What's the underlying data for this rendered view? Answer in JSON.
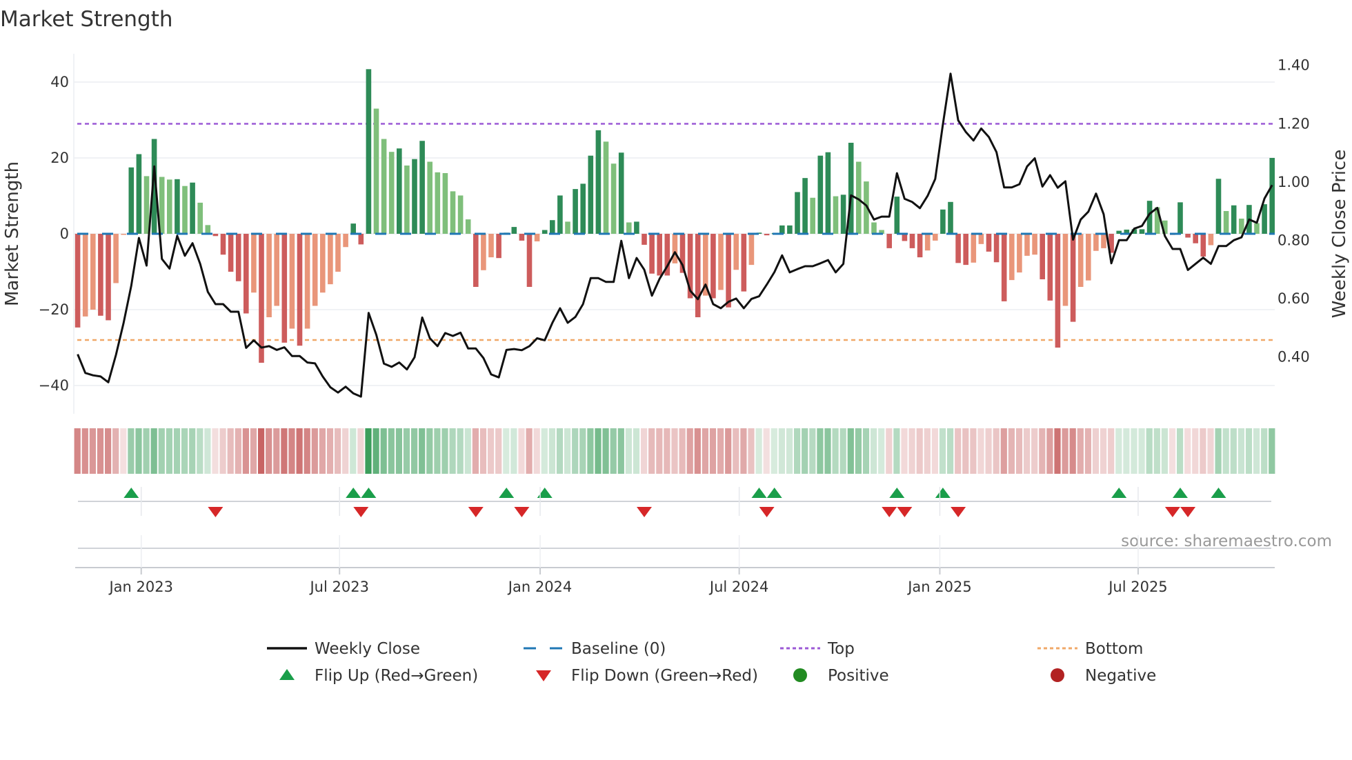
{
  "chart_data": {
    "type": "bar",
    "title": "Market Strength",
    "ylabel": "Market Strength",
    "y2label": "Weekly Close Price",
    "source": "source: sharemaestro.com",
    "ylim": [
      -47,
      50
    ],
    "y2lim": [
      0.22,
      1.5
    ],
    "yticks": [
      {
        "v": 40,
        "label": "40"
      },
      {
        "v": 20,
        "label": "20"
      },
      {
        "v": 0,
        "label": "0"
      },
      {
        "v": -20,
        "label": "−20"
      },
      {
        "v": -40,
        "label": "−40"
      }
    ],
    "y2ticks": [
      {
        "v": 1.4,
        "label": "1.40"
      },
      {
        "v": 1.2,
        "label": "1.20"
      },
      {
        "v": 1.0,
        "label": "1.00"
      },
      {
        "v": 0.8,
        "label": "0.80"
      },
      {
        "v": 0.6,
        "label": "0.60"
      },
      {
        "v": 0.4,
        "label": "0.40"
      }
    ],
    "xticks": [
      {
        "week": 8.3,
        "label": "Jan 2023"
      },
      {
        "week": 34.2,
        "label": "Jul 2023"
      },
      {
        "week": 60.4,
        "label": "Jan 2024"
      },
      {
        "week": 86.4,
        "label": "Jul 2024"
      },
      {
        "week": 112.6,
        "label": "Jan 2025"
      },
      {
        "week": 138.5,
        "label": "Jul 2025"
      }
    ],
    "top_level": 29,
    "bottom_level": -28,
    "baseline": 0,
    "strength": [
      -24.7,
      -21.8,
      -20,
      -21.6,
      -22.8,
      -13,
      -0.2,
      17.5,
      21,
      15.2,
      25,
      15,
      14.3,
      14.4,
      12.6,
      13.5,
      8.2,
      2.3,
      -0.6,
      -5.5,
      -10,
      -12.5,
      -21,
      -15.5,
      -34,
      -22,
      -19,
      -28.7,
      -25,
      -29.5,
      -25,
      -19,
      -15.5,
      -13.3,
      -10,
      -3.5,
      2.7,
      -2.8,
      43.4,
      33,
      25,
      21.6,
      22.5,
      18,
      19.7,
      24.5,
      19,
      16.2,
      16,
      11.2,
      10.1,
      3.8,
      -14,
      -9.6,
      -6.2,
      -6.4,
      0.3,
      1.8,
      -1.8,
      -14,
      -2,
      1,
      3.6,
      10.1,
      3.2,
      11.8,
      13.2,
      20.6,
      27.3,
      24.3,
      18.5,
      21.4,
      3,
      3.2,
      -2.9,
      -10.5,
      -11,
      -11,
      -7.8,
      -10.3,
      -17,
      -22,
      -16.3,
      -17,
      -14.8,
      -19.4,
      -9.5,
      -15.2,
      -8.2,
      0.3,
      -0.4,
      0.2,
      2.2,
      2.2,
      11,
      14.7,
      9.5,
      20.6,
      21.5,
      9.9,
      10.3,
      24,
      19,
      13.8,
      3,
      1,
      -3.8,
      9.8,
      -1.9,
      -3.8,
      -6.2,
      -4.4,
      -1.8,
      6.4,
      8.4,
      -7.7,
      -8.2,
      -7.6,
      -2.7,
      -4.7,
      -7.5,
      -17.8,
      -12.2,
      -10.2,
      -5.8,
      -5.5,
      -12,
      -17.6,
      -30,
      -19,
      -23.2,
      -14,
      -12.3,
      -4.5,
      -3.8,
      -5,
      0.8,
      1.1,
      1.2,
      1.2,
      8.7,
      7,
      3.5,
      -0.3,
      8.3,
      -1,
      -2.5,
      -6,
      -3,
      14.5,
      6,
      7.5,
      4,
      7.6,
      2.8,
      7.8,
      20
    ],
    "close": [
      0.407,
      0.343,
      0.335,
      0.331,
      0.311,
      0.405,
      0.515,
      0.642,
      0.806,
      0.711,
      1.051,
      0.734,
      0.701,
      0.813,
      0.745,
      0.788,
      0.717,
      0.621,
      0.579,
      0.579,
      0.553,
      0.553,
      0.429,
      0.455,
      0.43,
      0.435,
      0.422,
      0.431,
      0.401,
      0.401,
      0.379,
      0.376,
      0.331,
      0.294,
      0.276,
      0.296,
      0.273,
      0.262,
      0.549,
      0.474,
      0.375,
      0.364,
      0.379,
      0.355,
      0.397,
      0.533,
      0.462,
      0.435,
      0.48,
      0.47,
      0.481,
      0.427,
      0.427,
      0.394,
      0.338,
      0.328,
      0.422,
      0.425,
      0.421,
      0.435,
      0.462,
      0.455,
      0.515,
      0.565,
      0.515,
      0.535,
      0.579,
      0.668,
      0.668,
      0.655,
      0.655,
      0.796,
      0.668,
      0.737,
      0.697,
      0.608,
      0.666,
      0.709,
      0.757,
      0.713,
      0.625,
      0.596,
      0.646,
      0.579,
      0.565,
      0.587,
      0.598,
      0.565,
      0.597,
      0.606,
      0.646,
      0.689,
      0.746,
      0.688,
      0.699,
      0.709,
      0.709,
      0.719,
      0.73,
      0.688,
      0.717,
      0.952,
      0.938,
      0.917,
      0.869,
      0.879,
      0.879,
      1.028,
      0.94,
      0.929,
      0.908,
      0.95,
      1.008,
      1.195,
      1.369,
      1.209,
      1.169,
      1.14,
      1.181,
      1.152,
      1.1,
      0.979,
      0.979,
      0.99,
      1.051,
      1.079,
      0.982,
      1.021,
      0.978,
      1.0,
      0.8,
      0.869,
      0.896,
      0.958,
      0.887,
      0.719,
      0.798,
      0.798,
      0.838,
      0.847,
      0.889,
      0.909,
      0.812,
      0.768,
      0.768,
      0.696,
      0.717,
      0.738,
      0.717,
      0.778,
      0.778,
      0.798,
      0.808,
      0.869,
      0.858,
      0.941,
      0.987
    ],
    "flip_up_weeks": [
      7,
      36,
      38,
      56,
      61,
      89,
      91,
      107,
      113,
      136,
      144,
      149
    ],
    "flip_down_weeks": [
      18,
      37,
      52,
      58,
      74,
      90,
      106,
      108,
      115,
      143,
      145
    ],
    "legend": {
      "position": "bottom",
      "items": [
        {
          "key": "close",
          "label": "Weekly Close"
        },
        {
          "key": "baseline",
          "label": "Baseline (0)"
        },
        {
          "key": "top",
          "label": "Top"
        },
        {
          "key": "bottom",
          "label": "Bottom"
        },
        {
          "key": "flip_up",
          "label": "Flip Up (Red→Green)"
        },
        {
          "key": "flip_down",
          "label": "Flip Down (Green→Red)"
        },
        {
          "key": "positive",
          "label": "Positive"
        },
        {
          "key": "negative",
          "label": "Negative"
        }
      ]
    },
    "colors": {
      "pos_rising": "#2e8b57",
      "pos_falling": "#7fbf7b",
      "neg_falling": "#cd5c5c",
      "neg_rising": "#e9967a",
      "close": "#111111",
      "baseline": "#1f77b4",
      "top": "#9b59d6",
      "bottom": "#f0a868",
      "flip_up": "#1a9e4a",
      "flip_down": "#d62728",
      "positive": "#228b22",
      "negative": "#b22222",
      "heat_pos": "#3a9d5a",
      "heat_neg": "#c86464",
      "grid": "#eceef2"
    }
  }
}
